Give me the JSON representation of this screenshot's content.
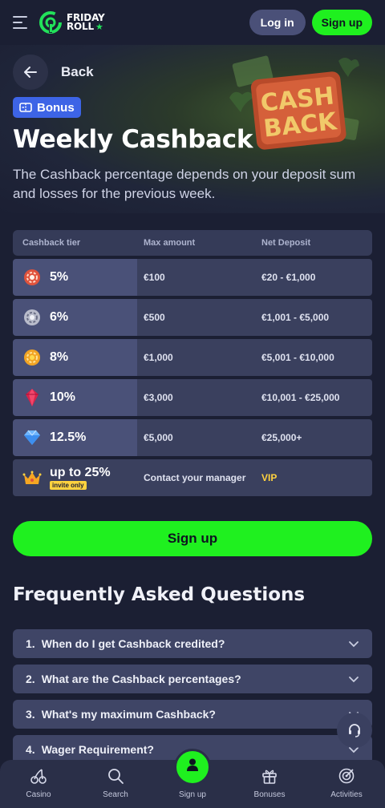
{
  "header": {
    "logo_text_line1": "FRIDAY",
    "logo_text_line2": "ROLL",
    "login_label": "Log in",
    "signup_label": "Sign up"
  },
  "hero": {
    "back_label": "Back",
    "badge_label": "Bonus",
    "art_text_line1": "CASH",
    "art_text_line2": "BACK",
    "title": "Weekly Cashback",
    "description": "The Cashback percentage depends on your deposit sum and losses for the previous week."
  },
  "table": {
    "headers": [
      "Cashback tier",
      "Max amount",
      "Net Deposit"
    ],
    "rows": [
      {
        "tier": "5%",
        "icon": "bronze-chip-icon",
        "max": "€100",
        "deposit": "€20 - €1,000"
      },
      {
        "tier": "6%",
        "icon": "silver-chip-icon",
        "max": "€500",
        "deposit": "€1,001 - €5,000"
      },
      {
        "tier": "8%",
        "icon": "gold-chip-icon",
        "max": "€1,000",
        "deposit": "€5,001 - €10,000"
      },
      {
        "tier": "10%",
        "icon": "ruby-icon",
        "max": "€3,000",
        "deposit": "€10,001 - €25,000"
      },
      {
        "tier": "12.5%",
        "icon": "diamond-icon",
        "max": "€5,000",
        "deposit": "€25,000+"
      },
      {
        "tier": "up to 25%",
        "icon": "crown-icon",
        "badge": "invite only",
        "max": "Contact your manager",
        "deposit": "VIP"
      }
    ]
  },
  "cta": {
    "signup_label": "Sign up"
  },
  "faq": {
    "title": "Frequently Asked Questions",
    "items": [
      {
        "num": "1.",
        "q": "When do I get Cashback credited?"
      },
      {
        "num": "2.",
        "q": "What are the Cashback percentages?"
      },
      {
        "num": "3.",
        "q": "What's my maximum Cashback?"
      },
      {
        "num": "4.",
        "q": "Wager Requirement?"
      }
    ]
  },
  "bottom_nav": {
    "items": [
      {
        "label": "Casino",
        "icon": "cherries-icon"
      },
      {
        "label": "Search",
        "icon": "search-icon"
      },
      {
        "label": "Sign up",
        "icon": "user-icon"
      },
      {
        "label": "Bonuses",
        "icon": "gift-icon"
      },
      {
        "label": "Activities",
        "icon": "target-icon"
      }
    ]
  },
  "colors": {
    "background": "#1b1f33",
    "accent_green": "#1ff01f",
    "badge_blue": "#3d64e6",
    "vip_yellow": "#ffd23f"
  }
}
